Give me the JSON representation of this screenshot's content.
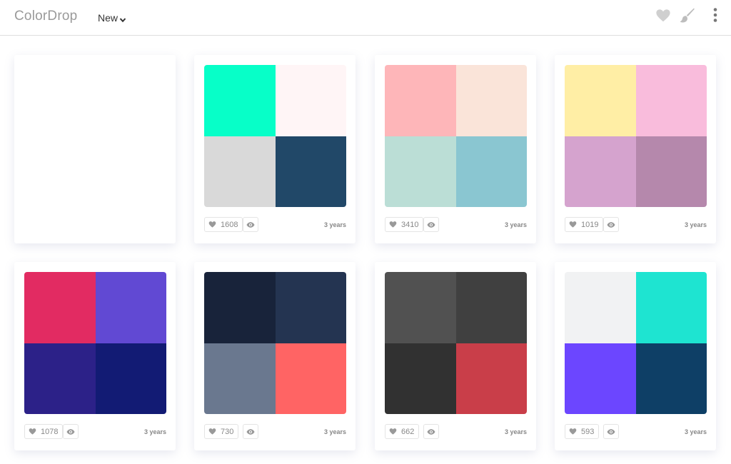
{
  "app": {
    "name": "ColorDrop"
  },
  "header": {
    "sort_label": "New",
    "icons": [
      "heart-icon",
      "brush-icon",
      "more-vertical-icon"
    ]
  },
  "colors": {
    "icon_gray": "#cfcfcf",
    "text_gray": "#888888",
    "border": "#e4e4e4"
  },
  "palettes": [
    {
      "colors": [
        "#07ffc8",
        "#fff5f6",
        "#d9d9d9",
        "#214868"
      ],
      "likes": "1608",
      "age": "3 years"
    },
    {
      "colors": [
        "#feb6b9",
        "#fae4d9",
        "#bbded6",
        "#8ac6d1"
      ],
      "likes": "3410",
      "age": "3 years"
    },
    {
      "colors": [
        "#ffeea5",
        "#f9bcdc",
        "#d5a3ce",
        "#b588ac"
      ],
      "likes": "1019",
      "age": "3 years"
    },
    {
      "colors": [
        "#e22b62",
        "#6149d3",
        "#2c2188",
        "#121b74"
      ],
      "likes": "1078",
      "age": "3 years"
    },
    {
      "colors": [
        "#18233a",
        "#243451",
        "#6a788f",
        "#ff6464"
      ],
      "likes": "730",
      "age": "3 years"
    },
    {
      "colors": [
        "#515151",
        "#404040",
        "#313131",
        "#c93e49"
      ],
      "likes": "662",
      "age": "3 years"
    },
    {
      "colors": [
        "#f1f2f3",
        "#1ee4d1",
        "#6c46ff",
        "#0e3f66"
      ],
      "likes": "593",
      "age": "3 years"
    }
  ]
}
